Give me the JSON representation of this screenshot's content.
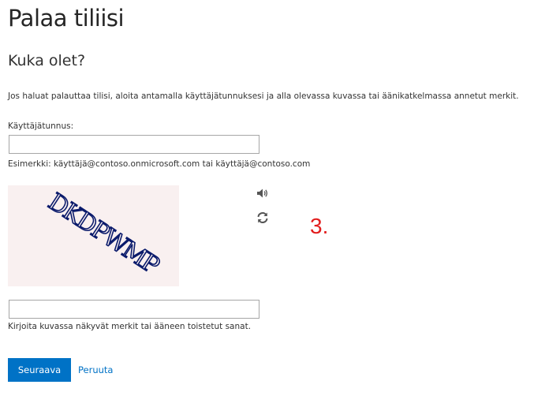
{
  "page": {
    "title": "Palaa tiliisi",
    "subtitle": "Kuka olet?",
    "instructions": "Jos haluat palauttaa tilisi, aloita antamalla käyttäjätunnuksesi ja alla olevassa kuvassa tai äänikatkelmassa annetut merkit."
  },
  "username": {
    "label": "Käyttäjätunnus:",
    "value": "",
    "hint": "Esimerkki: käyttäjä@contoso.onmicrosoft.com tai käyttäjä@contoso.com"
  },
  "captcha": {
    "image_text": "DKDPWMP",
    "audio_icon": "speaker-icon",
    "refresh_icon": "refresh-icon",
    "input_value": "",
    "hint": "Kirjoita kuvassa näkyvät merkit tai ääneen toistetut sanat."
  },
  "annotation": {
    "step": "3."
  },
  "actions": {
    "next_label": "Seuraava",
    "cancel_label": "Peruuta"
  },
  "colors": {
    "accent": "#0072c6",
    "annotation": "#e21d1d",
    "captcha_ink": "#0a1a6b",
    "captcha_bg": "#f9f0f0"
  }
}
